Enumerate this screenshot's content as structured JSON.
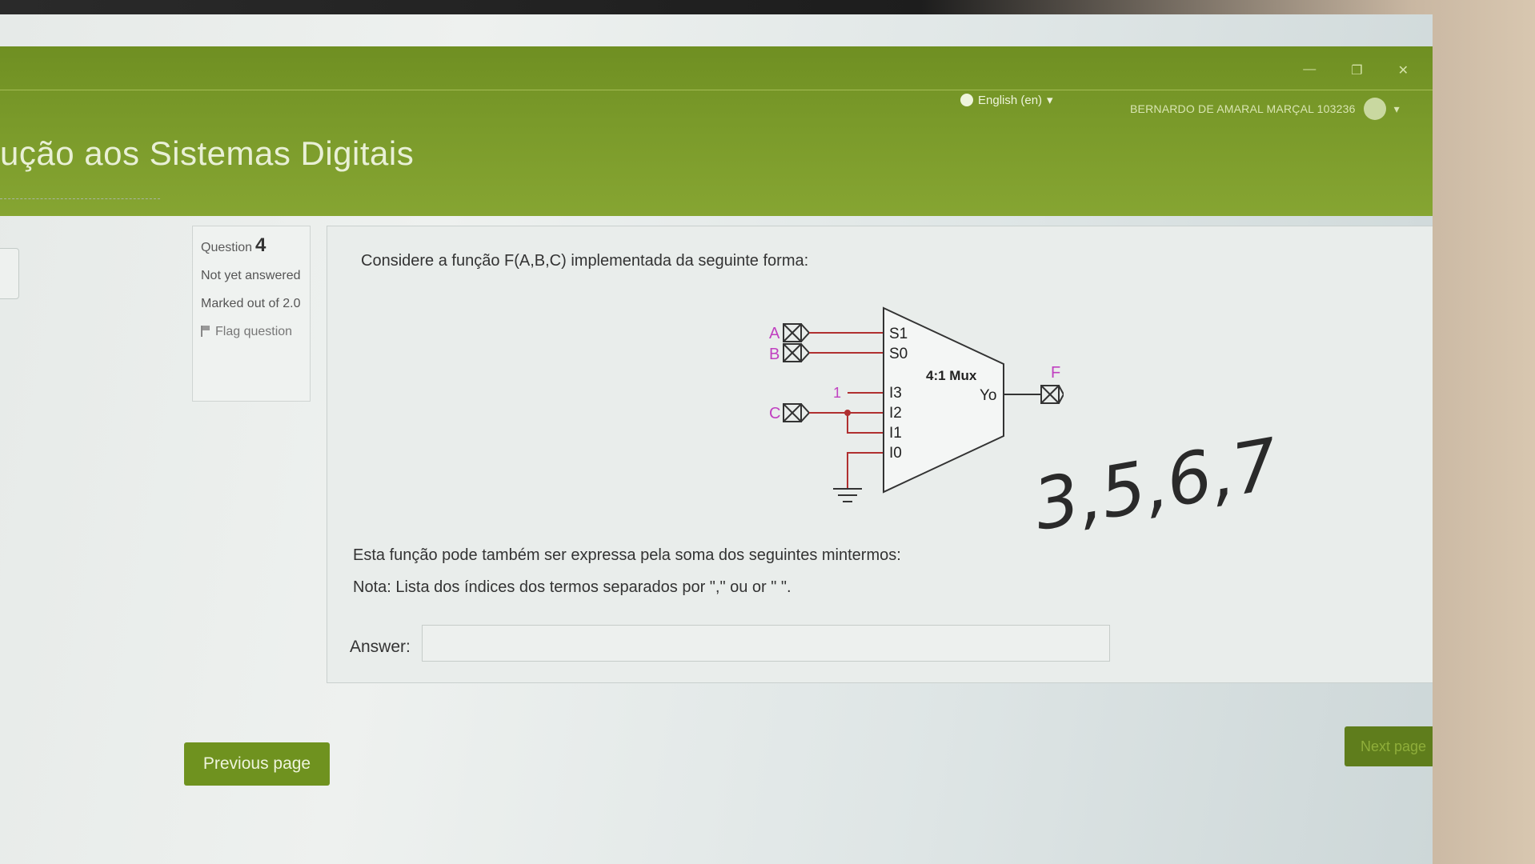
{
  "header": {
    "course_title": "ução aos Sistemas Digitais",
    "language": "English (en)",
    "user_name": "BERNARDO DE AMARAL MARÇAL 103236"
  },
  "question_info": {
    "label": "Question",
    "number": "4",
    "status": "Not yet answered",
    "marks": "Marked out of 2.0",
    "flag_label": "Flag question"
  },
  "question": {
    "intro": "Considere a função F(A,B,C) implementada da seguinte forma:",
    "body": "Esta função pode também ser expressa pela soma dos seguintes mintermos:",
    "note": "Nota: Lista dos índices dos termos separados por \",\" ou or \" \".",
    "answer_label": "Answer:",
    "answer_value": ""
  },
  "diagram": {
    "mux_label": "4:1 Mux",
    "inputs": [
      "A",
      "B",
      "C"
    ],
    "select_labels": [
      "S1",
      "S0"
    ],
    "data_labels": [
      "I3",
      "I2",
      "I1",
      "I0"
    ],
    "output_label": "Yo",
    "output_name": "F",
    "const_one": "1",
    "accent_color": "#c040c0",
    "wire_color": "#b03030"
  },
  "handwritten_note": "3,5,6,7",
  "navigation": {
    "prev_label": "Previous page",
    "next_label": "Next page"
  }
}
